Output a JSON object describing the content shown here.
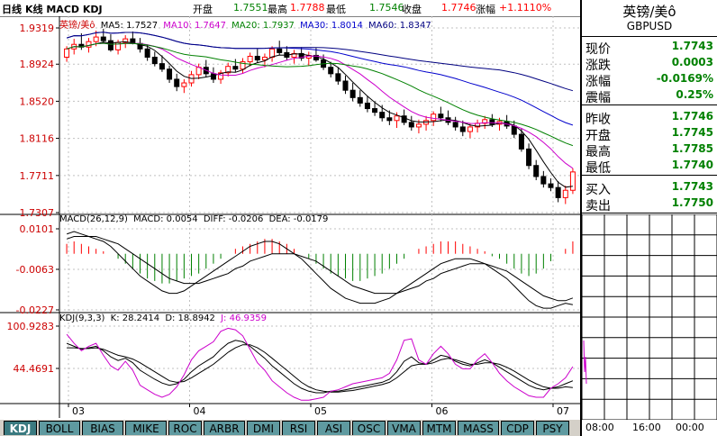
{
  "header": {
    "symbol_label": "日线",
    "indicators_label": "K线 MACD KDJ",
    "open_label": "开盘",
    "open_value": "1.7551",
    "high_label": "最高",
    "high_value": "1.7788",
    "low_label": "最低",
    "low_value": "1.7546",
    "close_label": "收盘",
    "close_value": "1.7746",
    "change_label": "涨幅",
    "change_value": "+1.1110%"
  },
  "ma_legend": {
    "name": "英镑/美ô",
    "ma5": "MA5: 1.7527",
    "ma10": "MA10: 1.7647",
    "ma20": "MA20: 1.7937",
    "ma30": "MA30: 1.8014",
    "ma60": "MA60: 1.8347"
  },
  "macd_legend": {
    "title": "MACD(26,12,9)",
    "macd": "MACD: 0.0054",
    "diff": "DIFF: -0.0206",
    "dea": "DEA: -0.0179"
  },
  "kdj_legend": {
    "title": "KDJ(9,3,3)",
    "k": "K: 28.2414",
    "d": "D: 18.8942",
    "j": "J: 46.9359"
  },
  "tabs": [
    "KDJ",
    "BOLL",
    "BIAS",
    "MIKE",
    "ROC",
    "ARBR",
    "DMI",
    "RSI",
    "ASI",
    "OSC",
    "VMA",
    "MTM",
    "MASS",
    "CDP",
    "PSY"
  ],
  "active_tab": "KDJ",
  "panel": {
    "title": "英镑/美ô",
    "code": "GBPUSD",
    "rows": [
      {
        "label": "现价",
        "value": "1.7743"
      },
      {
        "label": "涨跌",
        "value": "0.0003"
      },
      {
        "label": "涨幅",
        "value": "-0.0169%"
      },
      {
        "label": "震幅",
        "value": "0.25%"
      },
      {
        "label": "昨收",
        "value": "1.7746"
      },
      {
        "label": "开盘",
        "value": "1.7745"
      },
      {
        "label": "最高",
        "value": "1.7785"
      },
      {
        "label": "最低",
        "value": "1.7740"
      },
      {
        "label": "买入",
        "value": "1.7743"
      },
      {
        "label": "卖出",
        "value": "1.7750"
      }
    ],
    "times": [
      "08:00",
      "16:00",
      "00:00"
    ]
  },
  "colors": {
    "up": "#ff0000",
    "down": "#000000",
    "ma5": "#000000",
    "ma10": "#cc00cc",
    "ma20": "#008000",
    "ma30": "#0000cc",
    "ma60": "#000080",
    "axis_text": "#cc0000",
    "panel_value": "#008000"
  },
  "chart_data": [
    {
      "type": "candlestick",
      "title": "",
      "ylim": [
        1.7307,
        1.9319
      ],
      "y_ticks": [
        "1.9319",
        "1.8924",
        "1.8520",
        "1.8116",
        "1.7711",
        "1.7307"
      ],
      "x_ticks": [
        "03",
        "04",
        "05",
        "06",
        "07"
      ],
      "ohlc": [
        [
          1.9,
          1.912,
          1.895,
          1.909
        ],
        [
          1.909,
          1.92,
          1.903,
          1.914
        ],
        [
          1.914,
          1.926,
          1.908,
          1.911
        ],
        [
          1.911,
          1.921,
          1.905,
          1.917
        ],
        [
          1.917,
          1.929,
          1.912,
          1.922
        ],
        [
          1.922,
          1.931,
          1.915,
          1.918
        ],
        [
          1.918,
          1.925,
          1.906,
          1.908
        ],
        [
          1.908,
          1.919,
          1.903,
          1.916
        ],
        [
          1.916,
          1.924,
          1.91,
          1.92
        ],
        [
          1.92,
          1.928,
          1.914,
          1.915
        ],
        [
          1.915,
          1.921,
          1.905,
          1.909
        ],
        [
          1.909,
          1.914,
          1.896,
          1.9
        ],
        [
          1.9,
          1.906,
          1.89,
          1.893
        ],
        [
          1.893,
          1.902,
          1.884,
          1.887
        ],
        [
          1.887,
          1.891,
          1.872,
          1.876
        ],
        [
          1.876,
          1.882,
          1.863,
          1.868
        ],
        [
          1.868,
          1.876,
          1.861,
          1.872
        ],
        [
          1.872,
          1.885,
          1.868,
          1.881
        ],
        [
          1.881,
          1.893,
          1.876,
          1.889
        ],
        [
          1.889,
          1.897,
          1.878,
          1.882
        ],
        [
          1.882,
          1.889,
          1.872,
          1.876
        ],
        [
          1.876,
          1.886,
          1.871,
          1.883
        ],
        [
          1.883,
          1.894,
          1.879,
          1.89
        ],
        [
          1.89,
          1.898,
          1.884,
          1.887
        ],
        [
          1.887,
          1.899,
          1.882,
          1.895
        ],
        [
          1.895,
          1.905,
          1.89,
          1.901
        ],
        [
          1.901,
          1.909,
          1.894,
          1.897
        ],
        [
          1.897,
          1.904,
          1.889,
          1.9
        ],
        [
          1.9,
          1.912,
          1.895,
          1.909
        ],
        [
          1.909,
          1.918,
          1.902,
          1.905
        ],
        [
          1.905,
          1.912,
          1.897,
          1.9
        ],
        [
          1.9,
          1.908,
          1.893,
          1.904
        ],
        [
          1.904,
          1.911,
          1.896,
          1.899
        ],
        [
          1.899,
          1.906,
          1.891,
          1.902
        ],
        [
          1.902,
          1.91,
          1.895,
          1.897
        ],
        [
          1.897,
          1.903,
          1.886,
          1.889
        ],
        [
          1.889,
          1.895,
          1.878,
          1.882
        ],
        [
          1.882,
          1.889,
          1.87,
          1.874
        ],
        [
          1.874,
          1.88,
          1.86,
          1.864
        ],
        [
          1.864,
          1.872,
          1.852,
          1.856
        ],
        [
          1.856,
          1.864,
          1.846,
          1.85
        ],
        [
          1.85,
          1.858,
          1.84,
          1.844
        ],
        [
          1.844,
          1.852,
          1.836,
          1.84
        ],
        [
          1.84,
          1.848,
          1.83,
          1.834
        ],
        [
          1.834,
          1.842,
          1.826,
          1.831
        ],
        [
          1.831,
          1.84,
          1.823,
          1.836
        ],
        [
          1.836,
          1.843,
          1.826,
          1.829
        ],
        [
          1.829,
          1.836,
          1.82,
          1.824
        ],
        [
          1.824,
          1.832,
          1.817,
          1.827
        ],
        [
          1.827,
          1.836,
          1.82,
          1.831
        ],
        [
          1.831,
          1.841,
          1.825,
          1.838
        ],
        [
          1.838,
          1.846,
          1.83,
          1.834
        ],
        [
          1.834,
          1.842,
          1.826,
          1.829
        ],
        [
          1.829,
          1.835,
          1.82,
          1.824
        ],
        [
          1.824,
          1.831,
          1.814,
          1.819
        ],
        [
          1.819,
          1.828,
          1.812,
          1.824
        ],
        [
          1.824,
          1.832,
          1.818,
          1.828
        ],
        [
          1.828,
          1.836,
          1.822,
          1.832
        ],
        [
          1.832,
          1.838,
          1.824,
          1.827
        ],
        [
          1.827,
          1.834,
          1.82,
          1.83
        ],
        [
          1.83,
          1.837,
          1.822,
          1.825
        ],
        [
          1.825,
          1.831,
          1.812,
          1.816
        ],
        [
          1.816,
          1.822,
          1.797,
          1.8
        ],
        [
          1.8,
          1.806,
          1.778,
          1.782
        ],
        [
          1.782,
          1.788,
          1.766,
          1.77
        ],
        [
          1.77,
          1.776,
          1.758,
          1.762
        ],
        [
          1.762,
          1.768,
          1.754,
          1.758
        ],
        [
          1.758,
          1.765,
          1.742,
          1.747
        ],
        [
          1.747,
          1.76,
          1.74,
          1.755
        ],
        [
          1.755,
          1.779,
          1.751,
          1.775
        ]
      ]
    },
    {
      "type": "bar",
      "title": "MACD(26,12,9)",
      "ylim": [
        -0.0227,
        0.0101
      ],
      "y_ticks": [
        "0.0101",
        "-0.0063",
        "-0.0227"
      ],
      "macd_hist": [
        0.004,
        0.005,
        0.004,
        0.003,
        0.002,
        0.001,
        0.0,
        -0.002,
        -0.004,
        -0.006,
        -0.008,
        -0.01,
        -0.011,
        -0.012,
        -0.012,
        -0.011,
        -0.01,
        -0.009,
        -0.008,
        -0.006,
        -0.004,
        -0.002,
        0.0,
        0.002,
        0.003,
        0.004,
        0.005,
        0.006,
        0.006,
        0.005,
        0.004,
        0.002,
        0.0,
        -0.002,
        -0.004,
        -0.006,
        -0.008,
        -0.009,
        -0.01,
        -0.011,
        -0.011,
        -0.01,
        -0.009,
        -0.008,
        -0.006,
        -0.004,
        -0.002,
        0.0,
        0.002,
        0.003,
        0.004,
        0.005,
        0.005,
        0.005,
        0.004,
        0.003,
        0.002,
        0.001,
        -0.001,
        -0.002,
        -0.004,
        -0.006,
        -0.008,
        -0.009,
        -0.008,
        -0.006,
        -0.003,
        0.0,
        0.002,
        0.005
      ],
      "diff": [
        0.008,
        0.009,
        0.008,
        0.007,
        0.006,
        0.005,
        0.003,
        0.0,
        -0.003,
        -0.006,
        -0.009,
        -0.011,
        -0.013,
        -0.015,
        -0.016,
        -0.016,
        -0.015,
        -0.013,
        -0.011,
        -0.009,
        -0.007,
        -0.005,
        -0.003,
        -0.001,
        0.001,
        0.003,
        0.004,
        0.005,
        0.005,
        0.004,
        0.002,
        0.0,
        -0.002,
        -0.005,
        -0.008,
        -0.011,
        -0.014,
        -0.016,
        -0.018,
        -0.019,
        -0.02,
        -0.02,
        -0.02,
        -0.019,
        -0.018,
        -0.016,
        -0.014,
        -0.012,
        -0.01,
        -0.008,
        -0.006,
        -0.004,
        -0.003,
        -0.002,
        -0.002,
        -0.002,
        -0.003,
        -0.004,
        -0.006,
        -0.008,
        -0.01,
        -0.013,
        -0.016,
        -0.019,
        -0.021,
        -0.022,
        -0.022,
        -0.021,
        -0.02,
        -0.0206
      ],
      "dea": [
        0.006,
        0.007,
        0.007,
        0.007,
        0.007,
        0.006,
        0.005,
        0.004,
        0.002,
        0.0,
        -0.002,
        -0.004,
        -0.006,
        -0.008,
        -0.01,
        -0.011,
        -0.012,
        -0.012,
        -0.012,
        -0.011,
        -0.01,
        -0.009,
        -0.008,
        -0.006,
        -0.005,
        -0.003,
        -0.002,
        -0.001,
        0.0,
        0.0,
        0.0,
        0.0,
        -0.001,
        -0.002,
        -0.003,
        -0.005,
        -0.007,
        -0.009,
        -0.011,
        -0.013,
        -0.014,
        -0.015,
        -0.016,
        -0.016,
        -0.016,
        -0.016,
        -0.015,
        -0.014,
        -0.013,
        -0.011,
        -0.01,
        -0.008,
        -0.007,
        -0.006,
        -0.005,
        -0.004,
        -0.004,
        -0.004,
        -0.005,
        -0.006,
        -0.007,
        -0.009,
        -0.011,
        -0.013,
        -0.015,
        -0.017,
        -0.018,
        -0.019,
        -0.019,
        -0.0179
      ]
    },
    {
      "type": "line",
      "title": "KDJ(9,3,3)",
      "ylim": [
        0,
        100.9283
      ],
      "y_ticks": [
        "100.9283",
        "44.4691"
      ],
      "k": [
        78,
        74,
        70,
        72,
        74,
        68,
        60,
        55,
        58,
        52,
        42,
        36,
        30,
        25,
        22,
        24,
        30,
        40,
        48,
        54,
        60,
        70,
        78,
        82,
        80,
        74,
        66,
        58,
        48,
        40,
        32,
        24,
        18,
        14,
        12,
        12,
        14,
        14,
        16,
        18,
        20,
        22,
        24,
        26,
        30,
        40,
        54,
        60,
        52,
        50,
        56,
        62,
        60,
        54,
        50,
        48,
        52,
        56,
        52,
        46,
        40,
        34,
        28,
        22,
        18,
        16,
        18,
        20,
        24,
        28
      ],
      "d": [
        72,
        72,
        71,
        71,
        72,
        70,
        66,
        62,
        60,
        57,
        52,
        46,
        40,
        34,
        28,
        26,
        27,
        32,
        38,
        44,
        50,
        58,
        66,
        72,
        76,
        76,
        72,
        66,
        58,
        50,
        42,
        34,
        26,
        20,
        16,
        14,
        13,
        13,
        14,
        15,
        17,
        19,
        21,
        23,
        26,
        32,
        40,
        48,
        50,
        50,
        52,
        56,
        58,
        56,
        53,
        50,
        50,
        52,
        52,
        50,
        46,
        41,
        35,
        29,
        24,
        20,
        18,
        18,
        20,
        18.9
      ],
      "j": [
        90,
        78,
        68,
        74,
        78,
        62,
        48,
        42,
        54,
        42,
        22,
        16,
        10,
        6,
        10,
        20,
        36,
        56,
        68,
        74,
        80,
        94,
        98,
        96,
        88,
        70,
        52,
        42,
        28,
        20,
        12,
        6,
        2,
        2,
        4,
        6,
        14,
        16,
        20,
        24,
        26,
        28,
        30,
        32,
        38,
        56,
        82,
        84,
        56,
        50,
        64,
        74,
        64,
        50,
        44,
        44,
        56,
        64,
        52,
        38,
        28,
        20,
        14,
        8,
        6,
        6,
        18,
        24,
        32,
        46.9
      ]
    }
  ]
}
